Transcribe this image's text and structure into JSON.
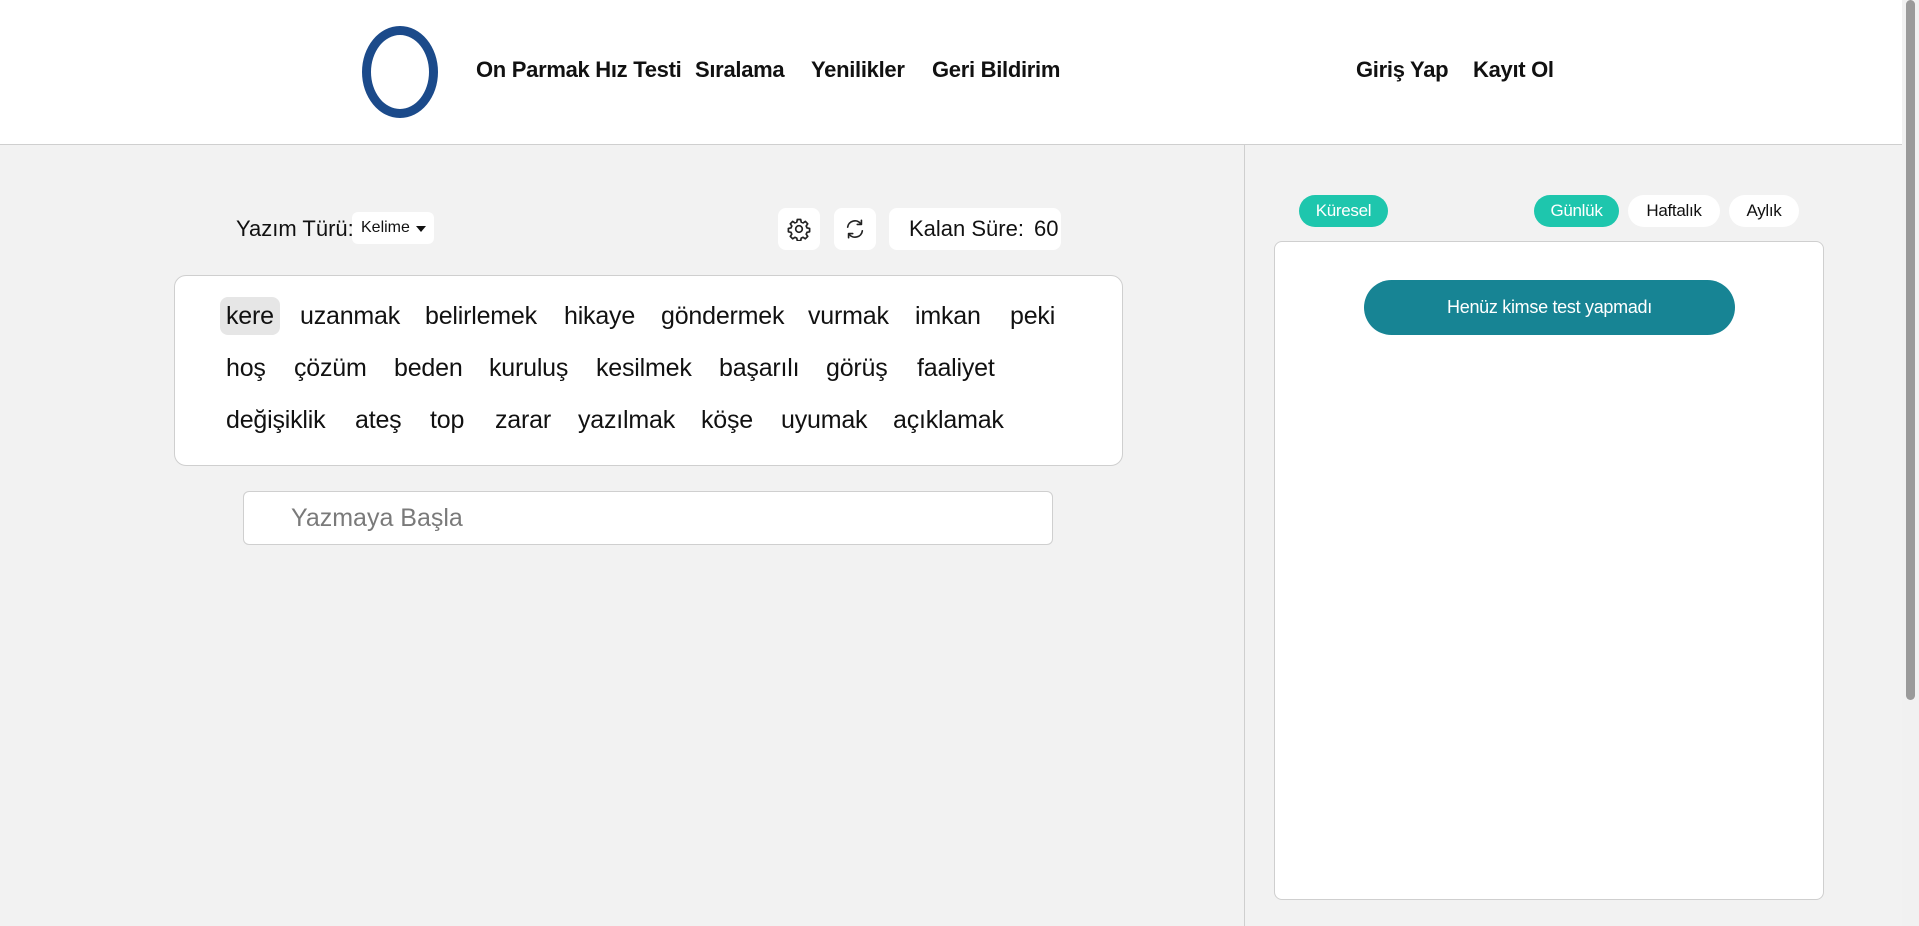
{
  "header": {
    "nav": [
      {
        "label": "On Parmak Hız Testi"
      },
      {
        "label": "Sıralama"
      },
      {
        "label": "Yenilikler"
      },
      {
        "label": "Geri Bildirim"
      }
    ],
    "auth": {
      "login": "Giriş Yap",
      "register": "Kayıt Ol"
    }
  },
  "test": {
    "type_label": "Yazım Türü:",
    "type_value": "Kelime",
    "timer_label": "Kalan Süre:",
    "timer_value": "60",
    "words": [
      "kere",
      "uzanmak",
      "belirlemek",
      "hikaye",
      "göndermek",
      "vurmak",
      "imkan",
      "peki",
      "hoş",
      "çözüm",
      "beden",
      "kuruluş",
      "kesilmek",
      "başarılı",
      "görüş",
      "faaliyet",
      "değişiklik",
      "ateş",
      "top",
      "zarar",
      "yazılmak",
      "köşe",
      "uyumak",
      "açıklamak"
    ],
    "input": {
      "value": "",
      "placeholder": "Yazmaya Başla"
    }
  },
  "leaderboard": {
    "scope_tab": "Küresel",
    "period_tabs": [
      "Günlük",
      "Haftalık",
      "Aylık"
    ],
    "empty_message": "Henüz kimse test yapmadı"
  },
  "colors": {
    "accent": "#1ec6ad",
    "message_bg": "#178494",
    "logo": "#1b4a8a"
  },
  "icons": {
    "settings": "gear-icon",
    "restart": "refresh-icon",
    "select": "caret-down-icon"
  }
}
